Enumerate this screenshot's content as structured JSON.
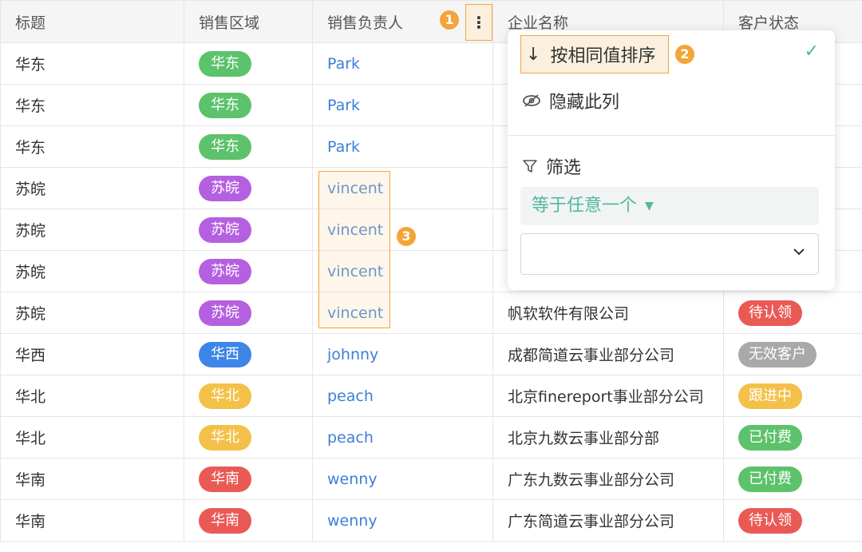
{
  "columns": [
    "标题",
    "销售区域",
    "销售负责人",
    "企业名称",
    "客户状态"
  ],
  "rows": [
    {
      "title": "华东",
      "region": "华东",
      "owner": "Park",
      "company": "",
      "status": ""
    },
    {
      "title": "华东",
      "region": "华东",
      "owner": "Park",
      "company": "",
      "status": ""
    },
    {
      "title": "华东",
      "region": "华东",
      "owner": "Park",
      "company": "",
      "status": ""
    },
    {
      "title": "苏皖",
      "region": "苏皖",
      "owner": "vincent",
      "company": "",
      "status": ""
    },
    {
      "title": "苏皖",
      "region": "苏皖",
      "owner": "vincent",
      "company": "",
      "status": ""
    },
    {
      "title": "苏皖",
      "region": "苏皖",
      "owner": "vincent",
      "company": "",
      "status": ""
    },
    {
      "title": "苏皖",
      "region": "苏皖",
      "owner": "vincent",
      "company": "帆软软件有限公司",
      "status": "待认领"
    },
    {
      "title": "华西",
      "region": "华西",
      "owner": "johnny",
      "company": "成都简道云事业部分公司",
      "status": "无效客户"
    },
    {
      "title": "华北",
      "region": "华北",
      "owner": "peach",
      "company": "北京finereport事业部分公司",
      "status": "跟进中"
    },
    {
      "title": "华北",
      "region": "华北",
      "owner": "peach",
      "company": "北京九数云事业部分部",
      "status": "已付费"
    },
    {
      "title": "华南",
      "region": "华南",
      "owner": "wenny",
      "company": "广东九数云事业部分公司",
      "status": "已付费"
    },
    {
      "title": "华南",
      "region": "华南",
      "owner": "wenny",
      "company": "广东简道云事业部分公司",
      "status": "待认领"
    }
  ],
  "region_colors": {
    "华东": "#5cc26b",
    "苏皖": "#b460e0",
    "华西": "#3d86e8",
    "华北": "#f3c149",
    "华南": "#ea5a55"
  },
  "status_colors": {
    "待认领": "#ea5a55",
    "无效客户": "#a9a9a9",
    "跟进中": "#f3c149",
    "已付费": "#5cc26b"
  },
  "markers": {
    "m1": "1",
    "m2": "2",
    "m3": "3"
  },
  "column_menu": {
    "button_glyph": "⋮",
    "sort_label": "按相同值排序",
    "hide_label": "隐藏此列",
    "filter_label": "筛选",
    "condition_value": "等于任意一个",
    "value_input": ""
  },
  "accent": "#f3a53a"
}
